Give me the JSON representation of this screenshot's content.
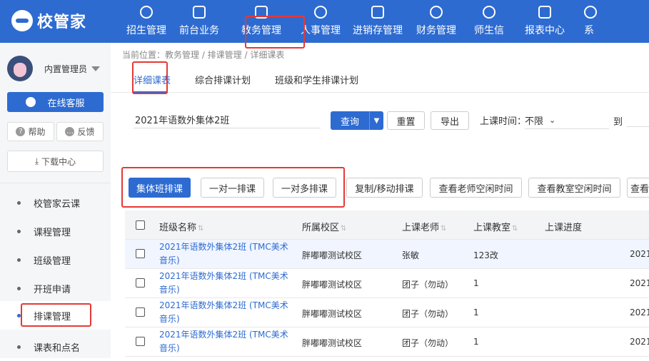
{
  "app": {
    "logo_text": "校管家"
  },
  "nav": {
    "items": [
      {
        "label": "招生管理",
        "icon": "person-plus-icon"
      },
      {
        "label": "前台业务",
        "icon": "monitor-icon"
      },
      {
        "label": "教务管理",
        "icon": "book-icon"
      },
      {
        "label": "人事管理",
        "icon": "person-icon"
      },
      {
        "label": "进销存管理",
        "icon": "arrow-box-icon"
      },
      {
        "label": "财务管理",
        "icon": "yen-shield-icon"
      },
      {
        "label": "师生信",
        "icon": "chat-icon"
      },
      {
        "label": "报表中心",
        "icon": "bar-chart-icon"
      },
      {
        "label": "系",
        "icon": "settings-icon"
      }
    ]
  },
  "sidebar": {
    "user_name": "内置管理员",
    "online_service": "在线客服",
    "help": "帮助",
    "feedback": "反馈",
    "download_center": "下载中心",
    "menu": [
      {
        "label": "校管家云课"
      },
      {
        "label": "课程管理"
      },
      {
        "label": "班级管理"
      },
      {
        "label": "开班申请"
      },
      {
        "label": "排课管理"
      },
      {
        "label": "课表和点名"
      }
    ]
  },
  "main": {
    "breadcrumb": "当前位置：教务管理 / 排课管理 / 详细课表",
    "tabs": [
      {
        "label": "详细课表"
      },
      {
        "label": "综合排课计划"
      },
      {
        "label": "班级和学生排课计划"
      }
    ],
    "filter": {
      "search_value": "2021年语数外集体2班",
      "query_label": "查询",
      "reset_label": "重置",
      "export_label": "导出",
      "time_label": "上课时间：",
      "time_value": "不限",
      "to_label": "到"
    },
    "actions": [
      {
        "label": "集体班排课"
      },
      {
        "label": "一对一排课"
      },
      {
        "label": "一对多排课"
      },
      {
        "label": "复制/移动排课"
      },
      {
        "label": "查看老师空闲时间"
      },
      {
        "label": "查看教室空闲时间"
      },
      {
        "label": "查看"
      }
    ],
    "table": {
      "headers": [
        "班级名称",
        "所属校区",
        "上课老师",
        "上课教室",
        "上课进度"
      ],
      "rows": [
        {
          "name": "2021年语数外集体2班 (TMC美术音乐)",
          "campus": "胖嘟嘟测试校区",
          "teacher": "张敏",
          "room": "123改",
          "date": "2021"
        },
        {
          "name": "2021年语数外集体2班 (TMC美术音乐)",
          "campus": "胖嘟嘟测试校区",
          "teacher": "团子（勿动）",
          "room": "1",
          "date": "2021"
        },
        {
          "name": "2021年语数外集体2班 (TMC美术音乐)",
          "campus": "胖嘟嘟测试校区",
          "teacher": "团子（勿动）",
          "room": "1",
          "date": "2021"
        },
        {
          "name": "2021年语数外集体2班 (TMC美术音乐)",
          "campus": "胖嘟嘟测试校区",
          "teacher": "团子（勿动）",
          "room": "1",
          "date": "2021"
        }
      ]
    }
  }
}
